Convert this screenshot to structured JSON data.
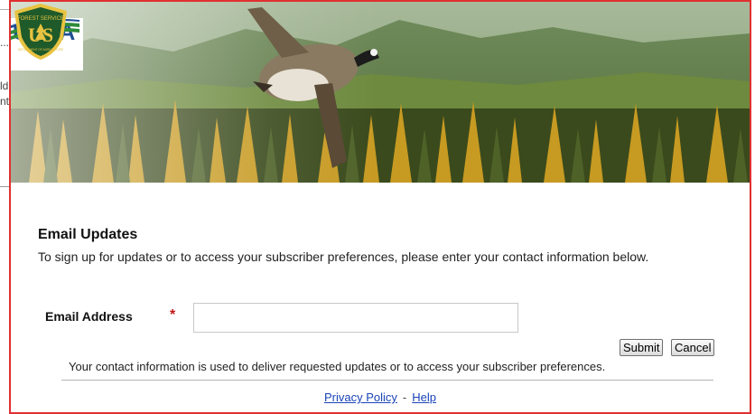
{
  "background_page": {
    "line1": "...",
    "line2": "ld",
    "line3": "nt"
  },
  "banner": {
    "usda_logo_text": "USDA",
    "agency_badge_top": "FOREST SERVICE",
    "agency_badge_mid": "US",
    "agency_badge_bottom": "DEPARTMENT OF AGRICULTURE"
  },
  "content": {
    "title": "Email Updates",
    "intro": "To sign up for updates or to access your subscriber preferences, please enter your contact information below."
  },
  "form": {
    "email_label": "Email Address",
    "required_marker": "*",
    "email_value": "",
    "submit_label": "Submit",
    "cancel_label": "Cancel"
  },
  "disclaimer": "Your contact information is used to deliver requested updates or to access your subscriber preferences.",
  "footer": {
    "privacy_label": "Privacy Policy",
    "separator": "-",
    "help_label": "Help"
  },
  "colors": {
    "frame_border": "#e03030",
    "usda_blue": "#1f4f93",
    "usda_green": "#2e8b3a",
    "link_blue": "#1a44b8",
    "required_red": "#c01818",
    "shield_green": "#1f5a2a",
    "shield_gold": "#e8c341"
  }
}
